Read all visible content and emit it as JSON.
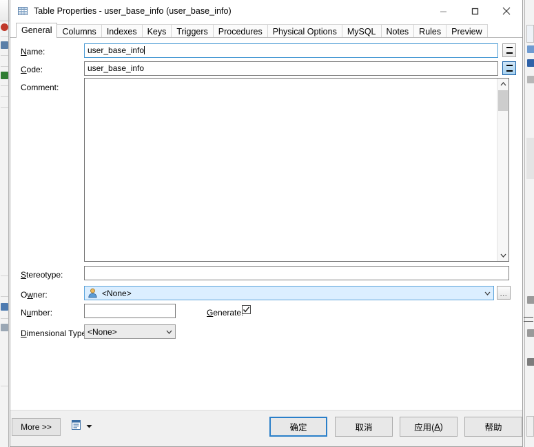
{
  "window": {
    "title": "Table Properties - user_base_info (user_base_info)",
    "icon": "table-icon",
    "minimize_label": "Minimize",
    "maximize_label": "Maximize",
    "close_label": "Close"
  },
  "tabs": [
    {
      "label": "General",
      "active": true
    },
    {
      "label": "Columns",
      "active": false
    },
    {
      "label": "Indexes",
      "active": false
    },
    {
      "label": "Keys",
      "active": false
    },
    {
      "label": "Triggers",
      "active": false
    },
    {
      "label": "Procedures",
      "active": false
    },
    {
      "label": "Physical Options",
      "active": false
    },
    {
      "label": "MySQL",
      "active": false
    },
    {
      "label": "Notes",
      "active": false
    },
    {
      "label": "Rules",
      "active": false
    },
    {
      "label": "Preview",
      "active": false
    }
  ],
  "form": {
    "name": {
      "label_pre": "",
      "label_accel": "N",
      "label_post": "ame:",
      "value": "user_base_info",
      "placeholder": "",
      "focused": true,
      "equals_button": "="
    },
    "code": {
      "label_pre": "",
      "label_accel": "C",
      "label_post": "ode:",
      "value": "user_base_info",
      "placeholder": "",
      "focused": false,
      "equals_button": "="
    },
    "comment": {
      "label": "Comment:",
      "value": "",
      "placeholder": ""
    },
    "stereotype": {
      "label_pre": "",
      "label_accel": "S",
      "label_post": "tereotype:",
      "value": "",
      "placeholder": ""
    },
    "owner": {
      "label_pre": "O",
      "label_accel": "w",
      "label_post": "ner:",
      "value": "<None>",
      "icon": "user-icon",
      "browse_button": "..."
    },
    "number": {
      "label_pre": "N",
      "label_accel": "u",
      "label_post": "mber:",
      "value": "",
      "placeholder": ""
    },
    "generate": {
      "label_pre": "",
      "label_accel": "G",
      "label_post": "enerate:",
      "checked": true
    },
    "dimensional_type": {
      "label_pre": "",
      "label_accel": "D",
      "label_post": "imensional Type:",
      "value": "<None>",
      "options": [
        "<None>"
      ]
    }
  },
  "footer": {
    "more_label": "More >>",
    "properties_menu_icon": "properties-icon",
    "properties_menu_caret": "▼",
    "ok_label": "确定",
    "cancel_label": "取消",
    "apply_label_pre": "应用(",
    "apply_label_accel": "A",
    "apply_label_post": ")",
    "help_label": "帮助"
  },
  "colors": {
    "accent": "#2a7fc9",
    "selection": "#dbeeff",
    "dialog_bg": "#ffffff",
    "footer_bg": "#f0f0f0",
    "field_border": "#7a7a7a"
  }
}
